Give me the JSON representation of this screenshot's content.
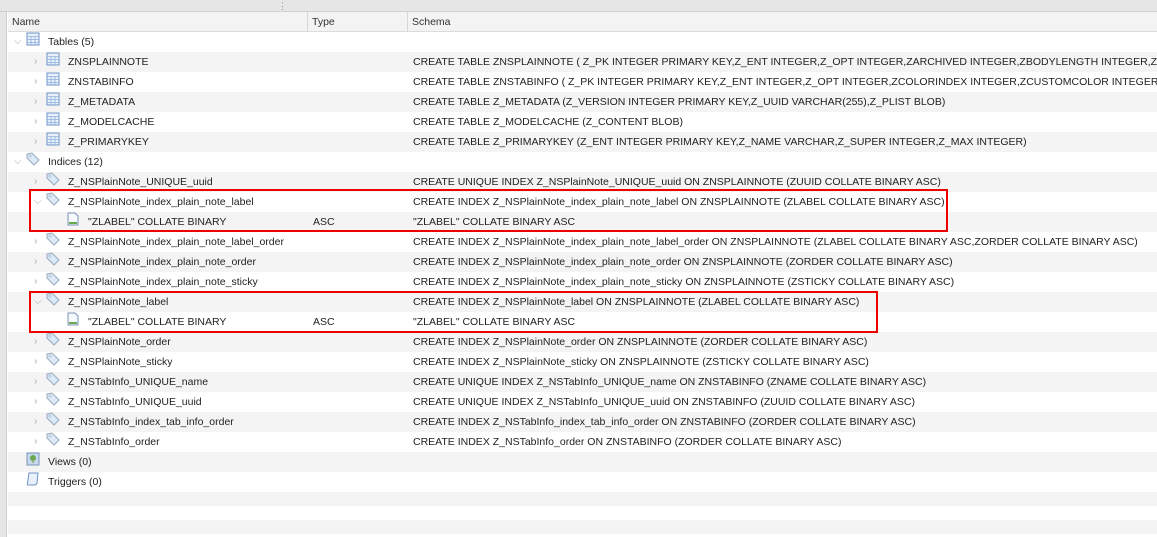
{
  "columns": {
    "name": "Name",
    "type": "Type",
    "schema": "Schema"
  },
  "groups": {
    "tables": {
      "label": "Tables (5)",
      "items": [
        {
          "name": "ZNSPLAINNOTE",
          "schema": "CREATE TABLE ZNSPLAINNOTE ( Z_PK INTEGER PRIMARY KEY,Z_ENT INTEGER,Z_OPT INTEGER,ZARCHIVED INTEGER,ZBODYLENGTH INTEGER,ZCHECK"
        },
        {
          "name": "ZNSTABINFO",
          "schema": "CREATE TABLE ZNSTABINFO ( Z_PK INTEGER PRIMARY KEY,Z_ENT INTEGER,Z_OPT INTEGER,ZCOLORINDEX INTEGER,ZCUSTOMCOLOR INTEGER,ZKIND"
        },
        {
          "name": "Z_METADATA",
          "schema": "CREATE TABLE Z_METADATA (Z_VERSION INTEGER PRIMARY KEY,Z_UUID VARCHAR(255),Z_PLIST BLOB)"
        },
        {
          "name": "Z_MODELCACHE",
          "schema": "CREATE TABLE Z_MODELCACHE (Z_CONTENT BLOB)"
        },
        {
          "name": "Z_PRIMARYKEY",
          "schema": "CREATE TABLE Z_PRIMARYKEY (Z_ENT INTEGER PRIMARY KEY,Z_NAME VARCHAR,Z_SUPER INTEGER,Z_MAX INTEGER)"
        }
      ]
    },
    "indices": {
      "label": "Indices (12)",
      "items": [
        {
          "name": "Z_NSPlainNote_UNIQUE_uuid",
          "schema": "CREATE UNIQUE INDEX Z_NSPlainNote_UNIQUE_uuid ON ZNSPLAINNOTE (ZUUID COLLATE BINARY ASC)"
        },
        {
          "name": "Z_NSPlainNote_index_plain_note_label",
          "schema": "CREATE INDEX Z_NSPlainNote_index_plain_note_label ON ZNSPLAINNOTE (ZLABEL COLLATE BINARY ASC)",
          "expanded": true,
          "child": {
            "name": "\"ZLABEL\" COLLATE BINARY",
            "type": "ASC",
            "schema": "\"ZLABEL\" COLLATE BINARY ASC"
          }
        },
        {
          "name": "Z_NSPlainNote_index_plain_note_label_order",
          "schema": "CREATE INDEX Z_NSPlainNote_index_plain_note_label_order ON ZNSPLAINNOTE (ZLABEL COLLATE BINARY ASC,ZORDER COLLATE BINARY ASC)"
        },
        {
          "name": "Z_NSPlainNote_index_plain_note_order",
          "schema": "CREATE INDEX Z_NSPlainNote_index_plain_note_order ON ZNSPLAINNOTE (ZORDER COLLATE BINARY ASC)"
        },
        {
          "name": "Z_NSPlainNote_index_plain_note_sticky",
          "schema": "CREATE INDEX Z_NSPlainNote_index_plain_note_sticky ON ZNSPLAINNOTE (ZSTICKY COLLATE BINARY ASC)"
        },
        {
          "name": "Z_NSPlainNote_label",
          "schema": "CREATE INDEX Z_NSPlainNote_label ON ZNSPLAINNOTE (ZLABEL COLLATE BINARY ASC)",
          "expanded": true,
          "child": {
            "name": "\"ZLABEL\" COLLATE BINARY",
            "type": "ASC",
            "schema": "\"ZLABEL\" COLLATE BINARY ASC"
          }
        },
        {
          "name": "Z_NSPlainNote_order",
          "schema": "CREATE INDEX Z_NSPlainNote_order ON ZNSPLAINNOTE (ZORDER COLLATE BINARY ASC)"
        },
        {
          "name": "Z_NSPlainNote_sticky",
          "schema": "CREATE INDEX Z_NSPlainNote_sticky ON ZNSPLAINNOTE (ZSTICKY COLLATE BINARY ASC)"
        },
        {
          "name": "Z_NSTabInfo_UNIQUE_name",
          "schema": "CREATE UNIQUE INDEX Z_NSTabInfo_UNIQUE_name ON ZNSTABINFO (ZNAME COLLATE BINARY ASC)"
        },
        {
          "name": "Z_NSTabInfo_UNIQUE_uuid",
          "schema": "CREATE UNIQUE INDEX Z_NSTabInfo_UNIQUE_uuid ON ZNSTABINFO (ZUUID COLLATE BINARY ASC)"
        },
        {
          "name": "Z_NSTabInfo_index_tab_info_order",
          "schema": "CREATE INDEX Z_NSTabInfo_index_tab_info_order ON ZNSTABINFO (ZORDER COLLATE BINARY ASC)"
        },
        {
          "name": "Z_NSTabInfo_order",
          "schema": "CREATE INDEX Z_NSTabInfo_order ON ZNSTABINFO (ZORDER COLLATE BINARY ASC)"
        }
      ]
    },
    "views": {
      "label": "Views (0)"
    },
    "triggers": {
      "label": "Triggers (0)"
    }
  },
  "colors": {
    "highlight": "#e00000",
    "stripe": "#f4f4f4"
  }
}
